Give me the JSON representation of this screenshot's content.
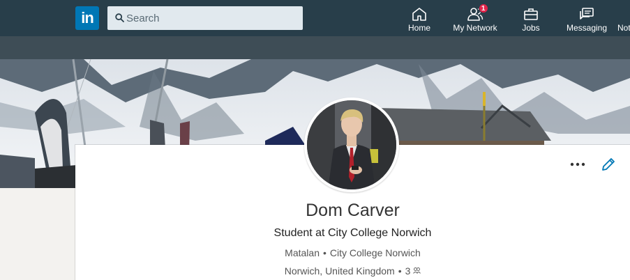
{
  "nav": {
    "logo_text": "in",
    "search": {
      "placeholder": "Search",
      "icon": "search-icon"
    },
    "items": [
      {
        "label": "Home",
        "icon": "home-icon"
      },
      {
        "label": "My Network",
        "icon": "network-icon",
        "badge": "1"
      },
      {
        "label": "Jobs",
        "icon": "briefcase-icon"
      },
      {
        "label": "Messaging",
        "icon": "messaging-icon"
      },
      {
        "label": "Notifications",
        "icon": "bell-icon"
      }
    ]
  },
  "profile": {
    "name": "Dom Carver",
    "headline": "Student at City College Norwich",
    "company": "Matalan",
    "school": "City College Norwich",
    "location": "Norwich, United Kingdom",
    "connections": "3",
    "more_icon": "more-icon",
    "edit_icon": "pencil-icon"
  },
  "colors": {
    "nav_bg": "#283e4a",
    "brand": "#0077b5",
    "badge": "#e0244a"
  }
}
